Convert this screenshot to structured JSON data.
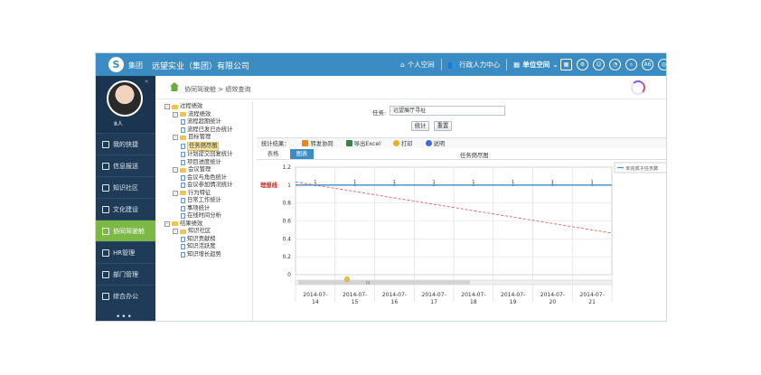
{
  "header": {
    "group_label": "集团",
    "company": "远望实业（集团）有限公司",
    "nav": [
      {
        "label": "个人空间",
        "icon": "home-icon"
      },
      {
        "label": "行政人力中心",
        "icon": "people-icon"
      },
      {
        "label": "单位空间",
        "icon": "building-icon"
      }
    ],
    "icon_buttons": [
      "grid-icon",
      "settings-icon",
      "chat-icon",
      "notification-icon",
      "search-icon",
      "language-icon",
      "power-icon"
    ],
    "icon_button_text": {
      "language-icon": "A6"
    }
  },
  "sidebar": {
    "username": "8人",
    "items": [
      {
        "label": "我的快捷",
        "icon": "star-icon",
        "active": false
      },
      {
        "label": "信息报送",
        "icon": "document-icon",
        "active": false
      },
      {
        "label": "知识社区",
        "icon": "book-icon",
        "active": false
      },
      {
        "label": "文化建设",
        "icon": "culture-icon",
        "active": false
      },
      {
        "label": "协同驾驶舱",
        "icon": "dashboard-icon",
        "active": true
      },
      {
        "label": "HR管理",
        "icon": "hr-icon",
        "active": false
      },
      {
        "label": "部门管理",
        "icon": "org-icon",
        "active": false
      },
      {
        "label": "综合办公",
        "icon": "office-icon",
        "active": false
      }
    ],
    "more": "•••"
  },
  "breadcrumb": "协同驾驶舱 > 绩效查询",
  "tree": [
    {
      "level": 0,
      "type": "folder",
      "pm": "-",
      "label": "过程绩效"
    },
    {
      "level": 1,
      "type": "folder",
      "pm": "-",
      "label": "流程绩效"
    },
    {
      "level": 2,
      "type": "leaf",
      "label": "流程超期统计"
    },
    {
      "level": 2,
      "type": "leaf",
      "label": "流程已发已办统计"
    },
    {
      "level": 1,
      "type": "folder",
      "pm": "-",
      "label": "目标管理"
    },
    {
      "level": 2,
      "type": "leaf",
      "label": "任务燃尽图",
      "selected": true
    },
    {
      "level": 2,
      "type": "leaf",
      "label": "计划提交回复统计"
    },
    {
      "level": 2,
      "type": "leaf",
      "label": "项目进度统计"
    },
    {
      "level": 1,
      "type": "folder",
      "pm": "-",
      "label": "会议管理"
    },
    {
      "level": 2,
      "type": "leaf",
      "label": "会议与角色统计"
    },
    {
      "level": 2,
      "type": "leaf",
      "label": "会议参加情况统计"
    },
    {
      "level": 1,
      "type": "folder",
      "pm": "-",
      "label": "行为特征"
    },
    {
      "level": 2,
      "type": "leaf",
      "label": "日常工作统计"
    },
    {
      "level": 2,
      "type": "leaf",
      "label": "事项统计"
    },
    {
      "level": 2,
      "type": "leaf",
      "label": "在线时间分析"
    },
    {
      "level": 0,
      "type": "folder",
      "pm": "-",
      "label": "结果绩效"
    },
    {
      "level": 1,
      "type": "folder",
      "pm": "-",
      "label": "知识社区"
    },
    {
      "level": 2,
      "type": "leaf",
      "label": "知识贡献榜"
    },
    {
      "level": 2,
      "type": "leaf",
      "label": "知识活跃度"
    },
    {
      "level": 2,
      "type": "leaf",
      "label": "知识增长趋势"
    }
  ],
  "query": {
    "task_label": "任务:",
    "task_value": "远望展厅寻址",
    "stat_button": "统计",
    "reset_button": "重置"
  },
  "toolbar": {
    "result_label": "统计结果：",
    "actions": [
      {
        "label": "转发协同",
        "icon": "forward-icon",
        "color": "#e08a2c"
      },
      {
        "label": "导出Excel",
        "icon": "excel-icon",
        "color": "#2f8a3c"
      },
      {
        "label": "打印",
        "icon": "print-icon",
        "color": "#e8b020"
      },
      {
        "label": "说明",
        "icon": "help-icon",
        "color": "#3a6fd0"
      }
    ]
  },
  "tabs": [
    {
      "label": "表格",
      "active": false
    },
    {
      "label": "图表",
      "active": true
    }
  ],
  "chart_data": {
    "type": "line",
    "title": "任务燃尽图",
    "categories": [
      "2014-07-14",
      "2014-07-15",
      "2014-07-16",
      "2014-07-17",
      "2014-07-18",
      "2014-07-19",
      "2014-07-20",
      "2014-07-21"
    ],
    "category_labels": [
      [
        "2014-07-",
        "14"
      ],
      [
        "2014-07-",
        "15"
      ],
      [
        "2014-07-",
        "16"
      ],
      [
        "2014-07-",
        "17"
      ],
      [
        "2014-07-",
        "18"
      ],
      [
        "2014-07-",
        "19"
      ],
      [
        "2014-07-",
        "20"
      ],
      [
        "2014-07-",
        "21"
      ]
    ],
    "series": [
      {
        "name": "未完成子任务数",
        "values": [
          1,
          1,
          1,
          1,
          1,
          1,
          1,
          1
        ],
        "data_labels": [
          "1",
          "1",
          "1",
          "1",
          "1",
          "1",
          "1",
          "1"
        ],
        "color": "#3a8cc3"
      },
      {
        "values": [
          1.0,
          0.93,
          0.86,
          0.79,
          0.71,
          0.64,
          0.57,
          0.5
        ],
        "color": "#e06060",
        "dashed": true
      }
    ],
    "ideal_label": "理想线",
    "legend": "top-right",
    "ylim": [
      0,
      1.2
    ],
    "yticks": [
      "0",
      "0.2",
      "0.4",
      "0.6",
      "0.8",
      "1",
      "1.2"
    ],
    "grid": true,
    "scrollbar_label": "III"
  }
}
